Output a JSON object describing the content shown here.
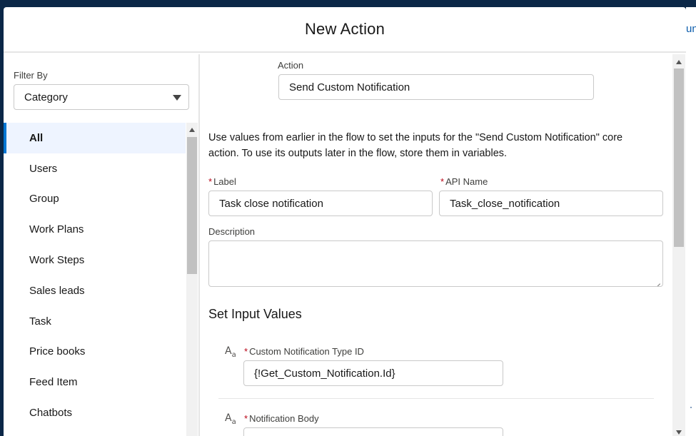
{
  "modal": {
    "title": "New Action"
  },
  "filter": {
    "label": "Filter By",
    "selected": "Category"
  },
  "categories": [
    "All",
    "Users",
    "Group",
    "Work Plans",
    "Work Steps",
    "Sales leads",
    "Task",
    "Price books",
    "Feed Item",
    "Chatbots"
  ],
  "active_category": "All",
  "action": {
    "label": "Action",
    "value": "Send Custom Notification"
  },
  "help_text": "Use values from earlier in the flow to set the inputs for the \"Send Custom Notification\" core action. To use its outputs later in the flow, store them in variables.",
  "label_field": {
    "required": "*",
    "label": "Label",
    "value": "Task close notification"
  },
  "api_name_field": {
    "required": "*",
    "label": "API Name",
    "value": "Task_close_notification"
  },
  "description_field": {
    "label": "Description",
    "value": ""
  },
  "inputs_section": {
    "title": "Set Input Values"
  },
  "input_values": [
    {
      "type_icon": "text-type-icon",
      "required": "*",
      "label": "Custom Notification Type ID",
      "value": "{!Get_Custom_Notification.Id}"
    },
    {
      "type_icon": "text-type-icon",
      "required": "*",
      "label": "Notification Body",
      "value": ""
    }
  ],
  "background_peek": {
    "text": "un"
  }
}
